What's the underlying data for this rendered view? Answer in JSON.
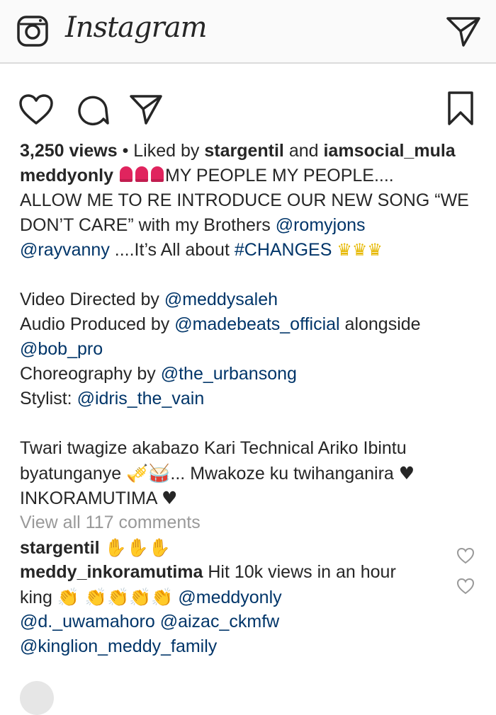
{
  "header": {
    "logo_text": "Instagram",
    "icons": [
      "camera-icon",
      "direct-message-icon"
    ]
  },
  "actions": [
    "heart-icon",
    "comment-icon",
    "share-icon",
    "bookmark-icon"
  ],
  "stats": {
    "views": "3,250 views",
    "liked_prefix": " • Liked by ",
    "liker1": "stargentil",
    "and_text": " and ",
    "liker2": "iamsocial_mula"
  },
  "caption": {
    "username": "meddyonly",
    "line1": "MY PEOPLE MY PEOPLE....",
    "line2": "ALLOW ME TO RE INTRODUCE OUR NEW SONG “WE",
    "line3a": "DON’T CARE” with my Brothers ",
    "line3_mention": "@romyjons",
    "line4_mention": "@rayvanny",
    "line4_text": " ....It’s All about ",
    "line4_hashtag": "#CHANGES",
    "line5a": "Video Directed by ",
    "line5_mention": "@meddysaleh",
    "line6a": "Audio Produced by ",
    "line6_mention": "@madebeats_official",
    "line6b": " alongside",
    "line7_mention": "@bob_pro",
    "line8a": "Choreography by ",
    "line8_mention": "@the_urbansong",
    "line9a": "Stylist: ",
    "line9_mention": "@idris_the_vain",
    "line10": "Twari twagize akabazo Kari Technical Ariko Ibintu",
    "line11a": "byatunganye ",
    "line11b": "... Mwakoze ku twihanganira ",
    "line12": "INKORAMUTIMA "
  },
  "view_all": "View all 117 comments",
  "comments": [
    {
      "username": "stargentil",
      "text": ""
    },
    {
      "username": "meddy_inkoramutima",
      "text_line1": " Hit 10k views in an hour",
      "text_line2": "king ",
      "mention1": "@meddyonly",
      "mention2": "@d._uwamahoro",
      "mention3": "@aizac_ckmfw",
      "mention4": "@kinglion_meddy_family"
    }
  ]
}
